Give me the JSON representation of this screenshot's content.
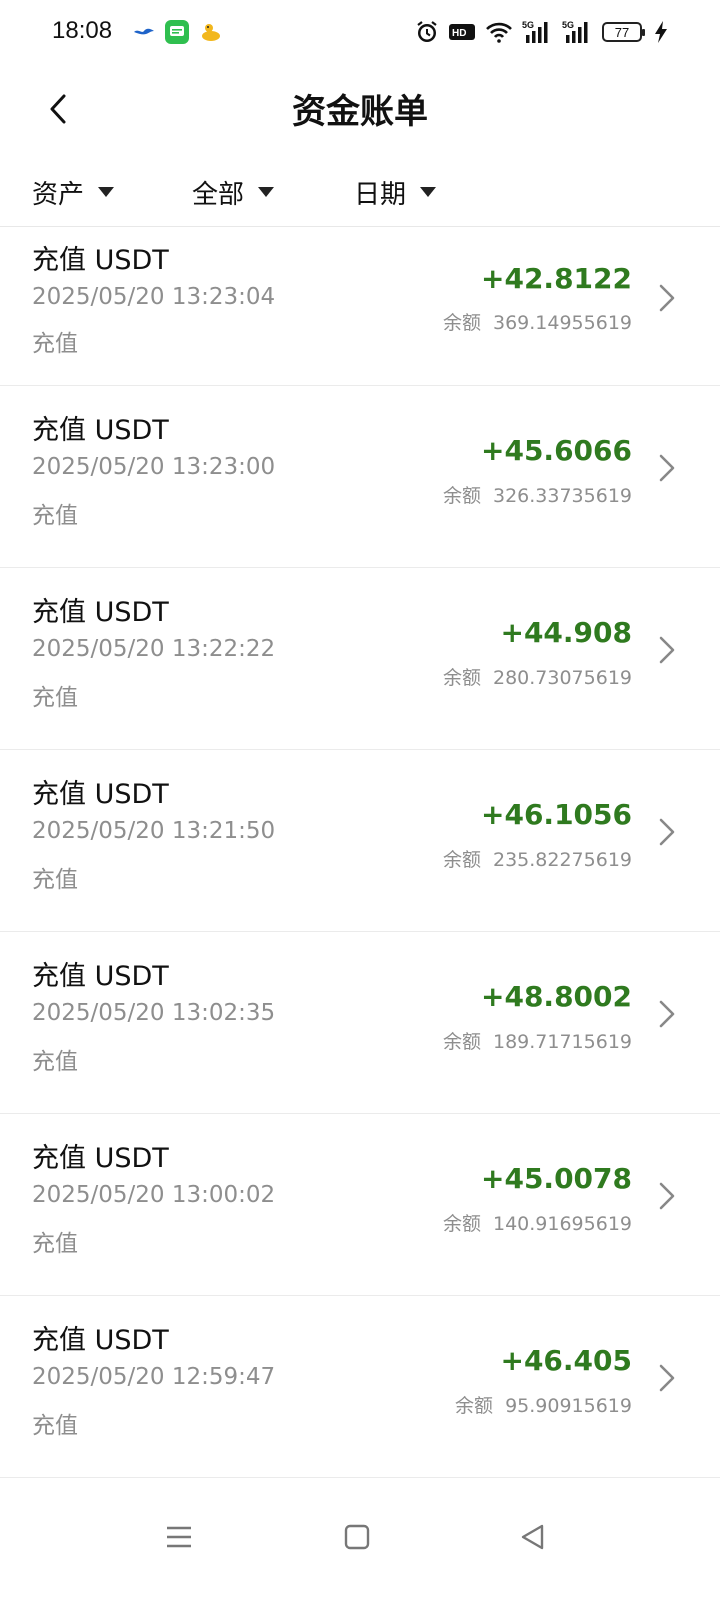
{
  "status_bar": {
    "time": "18:08",
    "battery": "77",
    "icons": [
      "alarm-icon",
      "hd-icon",
      "wifi-icon",
      "signal-5g-icon",
      "signal-5g-icon",
      "battery-icon",
      "charging-icon"
    ]
  },
  "header": {
    "title": "资金账单",
    "back_icon": "chevron-left-icon"
  },
  "filters": [
    {
      "label": "资产"
    },
    {
      "label": "全部"
    },
    {
      "label": "日期"
    }
  ],
  "transactions": [
    {
      "name": "充值 USDT",
      "date": "2025/05/20 13:23:04",
      "type": "充值",
      "amount": "+42.8122",
      "balance_label": "余额",
      "balance": "369.14955619"
    },
    {
      "name": "充值 USDT",
      "date": "2025/05/20 13:23:00",
      "type": "充值",
      "amount": "+45.6066",
      "balance_label": "余额",
      "balance": "326.33735619"
    },
    {
      "name": "充值 USDT",
      "date": "2025/05/20 13:22:22",
      "type": "充值",
      "amount": "+44.908",
      "balance_label": "余额",
      "balance": "280.73075619"
    },
    {
      "name": "充值 USDT",
      "date": "2025/05/20 13:21:50",
      "type": "充值",
      "amount": "+46.1056",
      "balance_label": "余额",
      "balance": "235.82275619"
    },
    {
      "name": "充值 USDT",
      "date": "2025/05/20 13:02:35",
      "type": "充值",
      "amount": "+48.8002",
      "balance_label": "余额",
      "balance": "189.71715619"
    },
    {
      "name": "充值 USDT",
      "date": "2025/05/20 13:00:02",
      "type": "充值",
      "amount": "+45.0078",
      "balance_label": "余额",
      "balance": "140.91695619"
    },
    {
      "name": "充值 USDT",
      "date": "2025/05/20 12:59:47",
      "type": "充值",
      "amount": "+46.405",
      "balance_label": "余额",
      "balance": "95.90915619"
    }
  ],
  "colors": {
    "positive": "#2f7a1f",
    "secondary_text": "#8e8e8e"
  },
  "nav": [
    "menu-icon",
    "home-square-icon",
    "back-triangle-icon"
  ]
}
